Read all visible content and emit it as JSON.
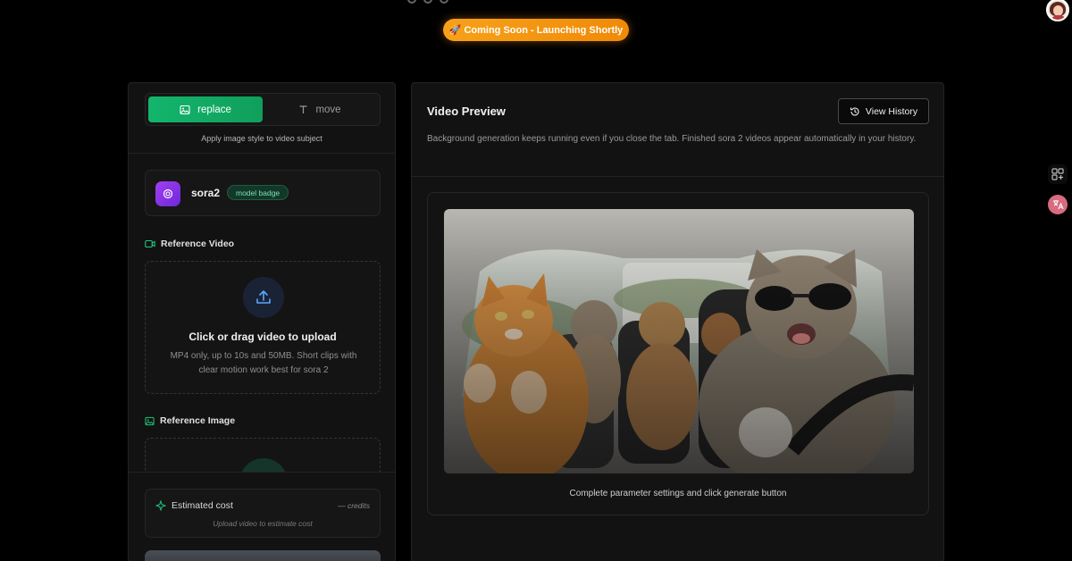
{
  "banner": {
    "text": "🚀 Coming Soon - Launching Shortly"
  },
  "mode_tabs": [
    {
      "label": "replace",
      "icon": "image-icon",
      "active": true
    },
    {
      "label": "move",
      "icon": "text-icon",
      "active": false
    }
  ],
  "mode_caption": "Apply image style to video subject",
  "model": {
    "name": "sora2",
    "badge": "model badge"
  },
  "reference_video": {
    "label": "Reference Video",
    "upload_title": "Click or drag video to upload",
    "upload_desc": "MP4 only, up to 10s and 50MB. Short clips with clear motion work best for sora 2"
  },
  "reference_image": {
    "label": "Reference Image"
  },
  "cost": {
    "title": "Estimated cost",
    "value": "— credits",
    "hint": "Upload video to estimate cost"
  },
  "preview": {
    "title": "Video Preview",
    "history_button": "View History",
    "description": "Background generation keeps running even if you close the tab. Finished sora 2 videos appear automatically in your history.",
    "caption": "Complete parameter settings and click generate button"
  },
  "colors": {
    "accent_green": "#13b56c",
    "banner_orange": "#f08a07",
    "model_purple": "#8b2fe6"
  }
}
